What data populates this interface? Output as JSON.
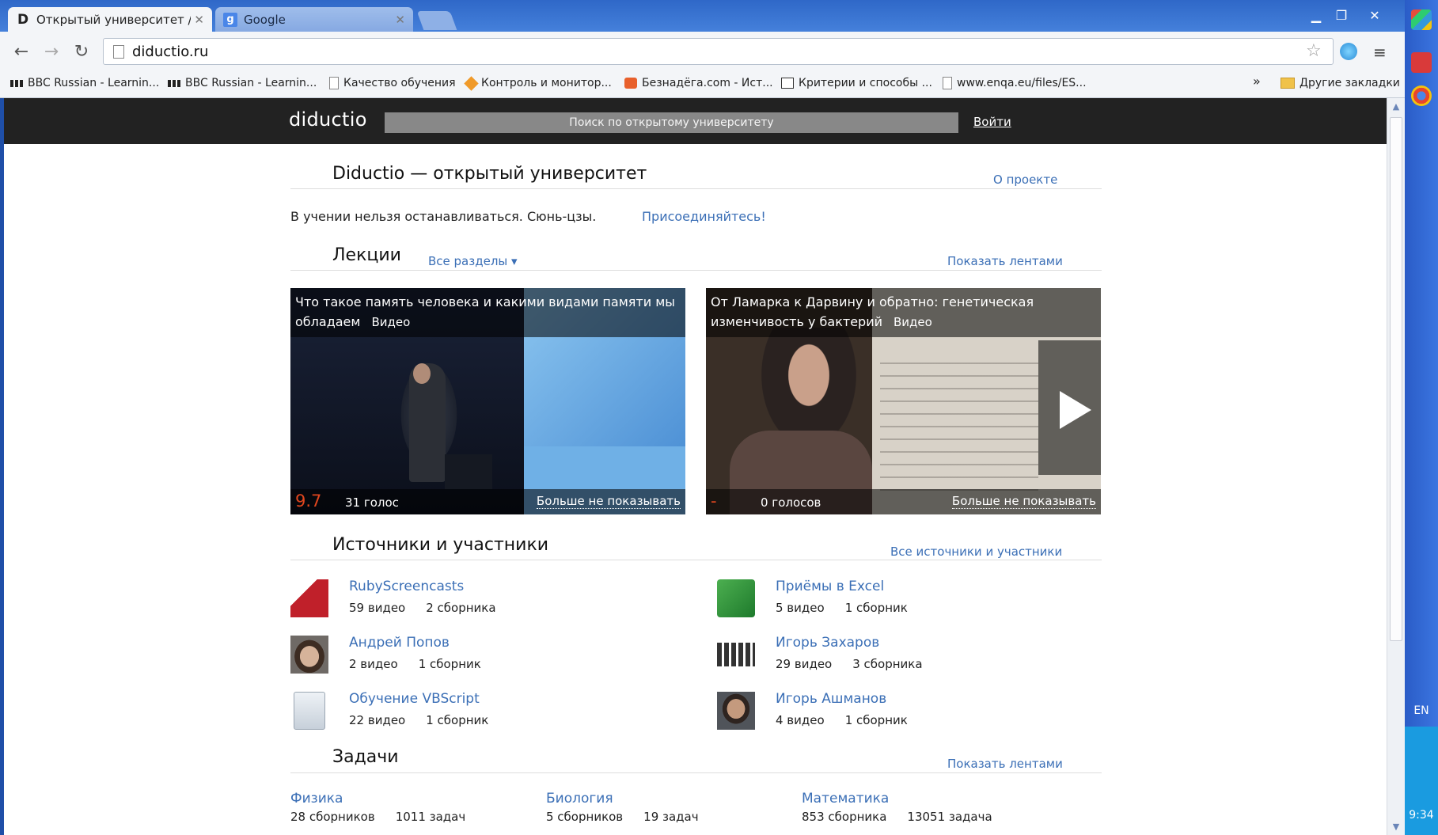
{
  "browser": {
    "tabs": [
      {
        "label": "Открытый университет / Di",
        "favicon": "D"
      },
      {
        "label": "Google",
        "favicon": "g"
      }
    ],
    "url": "diductio.ru",
    "bookmarks": [
      {
        "label": "BBC Russian - Learnin...",
        "icon": "bbc-icon"
      },
      {
        "label": "BBC Russian - Learnin...",
        "icon": "bbc-icon"
      },
      {
        "label": "Качество обучения",
        "icon": "page-icon"
      },
      {
        "label": "Контроль и монитор...",
        "icon": "diamond-icon"
      },
      {
        "label": "Безнадёга.com - Ист...",
        "icon": "flame-icon"
      },
      {
        "label": "Критерии и способы ...",
        "icon": "obs-icon"
      },
      {
        "label": "www.enqa.eu/files/ES...",
        "icon": "page-icon"
      }
    ],
    "more_bookmarks": "»",
    "other_bookmarks": "Другие закладки",
    "taskbar": {
      "lang": "EN",
      "time": "9:34"
    }
  },
  "site": {
    "logo": "diductio",
    "search_placeholder": "Поиск по открытому университету",
    "login": "Войти",
    "title": "Diductio — открытый университет",
    "about": "О проекте",
    "motto": "В учении нельзя останавливаться. Сюнь-цзы.",
    "join": "Присоединяйтесь!",
    "lectures": {
      "title": "Лекции",
      "all_sections": "Все разделы ▾",
      "show_feeds": "Показать лентами",
      "cards": [
        {
          "title": "Что такое память человека и какими видами памяти мы обладаем",
          "type": "Видео",
          "rating": "9.7",
          "votes": "31 голос",
          "hide": "Больше не показывать"
        },
        {
          "title": "От Ламарка к Дарвину и обратно: генетическая изменчивость у бактерий",
          "type": "Видео",
          "rating": "-",
          "votes": "0 голосов",
          "hide": "Больше не показывать"
        }
      ]
    },
    "sources": {
      "title": "Источники и участники",
      "all": "Все источники и участники",
      "items": [
        {
          "name": "RubyScreencasts",
          "videos": "59 видео",
          "collections": "2 сборника"
        },
        {
          "name": "Андрей Попов",
          "videos": "2 видео",
          "collections": "1 сборник"
        },
        {
          "name": "Обучение VBScript",
          "videos": "22 видео",
          "collections": "1 сборник"
        },
        {
          "name": "Приёмы в Excel",
          "videos": "5 видео",
          "collections": "1 сборник"
        },
        {
          "name": "Игорь Захаров",
          "videos": "29 видео",
          "collections": "3 сборника"
        },
        {
          "name": "Игорь Ашманов",
          "videos": "4 видео",
          "collections": "1 сборник"
        }
      ]
    },
    "tasks": {
      "title": "Задачи",
      "show_feeds": "Показать лентами",
      "items": [
        {
          "name": "Физика",
          "collections": "28 сборников",
          "tasks": "1011 задач"
        },
        {
          "name": "Биология",
          "collections": "5 сборников",
          "tasks": "19 задач"
        },
        {
          "name": "Математика",
          "collections": "853 сборника",
          "tasks": "13051 задача"
        }
      ]
    }
  }
}
